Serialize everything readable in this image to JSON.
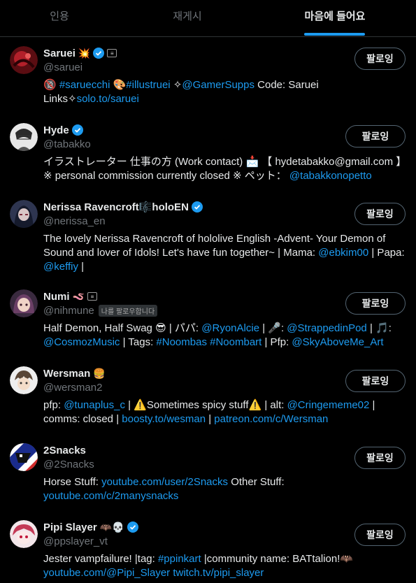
{
  "tabs": [
    {
      "label": "인용"
    },
    {
      "label": "재게시"
    },
    {
      "label": "마음에 들어요"
    }
  ],
  "colors": {
    "link": "#1d9bf0",
    "verified": "#1d9bf0",
    "muted": "#71767b"
  },
  "users": [
    {
      "name": "Saruei",
      "name_emoji": "💥",
      "handle": "@saruei",
      "button": "팔로잉",
      "bio": [
        "🔞 ",
        {
          "l": "#saruecchi"
        },
        " 🎨",
        {
          "l": "#illustruei"
        },
        " ✧",
        {
          "l": "@GamerSupps"
        },
        " Code: Saruei Links✧",
        {
          "l": "solo.to/saruei"
        }
      ]
    },
    {
      "name": "Hyde",
      "handle": "@tabakko",
      "button": "팔로잉",
      "bio": [
        "イラストレーター 仕事の方 (Work contact) 📩 【 hydetabakko@gmail.com 】 ※ personal commission currently closed ※ ペット： ",
        {
          "l": "@tabakkonopetto"
        }
      ]
    },
    {
      "name": "Nerissa Ravencroft🎼holoEN",
      "handle": "@nerissa_en",
      "button": "팔로잉",
      "bio": [
        "The lovely Nerissa Ravencroft of hololive English -Advent- Your Demon of Sound and lover of Idols! Let's have fun together~ | Mama: ",
        {
          "l": "@ebkim00"
        },
        " | Papa: ",
        {
          "l": "@keffiy"
        },
        " |"
      ]
    },
    {
      "name": "Numi",
      "name_emoji": "🪱",
      "handle": "@nihmune",
      "follows_you": "나를 팔로우합니다",
      "button": "팔로잉",
      "bio": [
        "Half Demon, Half Swag 😎 | パパ: ",
        {
          "l": "@RyonAlcie"
        },
        " | 🎤: ",
        {
          "l": "@StrappedinPod"
        },
        " | 🎵: ",
        {
          "l": "@CosmozMusic"
        },
        " | Tags: ",
        {
          "l": "#Noombas"
        },
        " ",
        {
          "l": "#Noombart"
        },
        " | Pfp: ",
        {
          "l": "@SkyAboveMe_Art"
        }
      ]
    },
    {
      "name": "Wersman",
      "name_emoji": "🍔",
      "handle": "@wersman2",
      "button": "팔로잉",
      "bio": [
        "pfp: ",
        {
          "l": "@tunaplus_c"
        },
        " | ⚠️Sometimes spicy stuff⚠️ | alt: ",
        {
          "l": "@Cringememe02"
        },
        " | comms: closed | ",
        {
          "l": "boosty.to/wesman"
        },
        " | ",
        {
          "l": "patreon.com/c/Wersman"
        }
      ]
    },
    {
      "name": "2Snacks",
      "handle": "@2Snacks",
      "button": "팔로잉",
      "bio": [
        "Horse Stuff: ",
        {
          "l": "youtube.com/user/2Snacks"
        },
        " Other Stuff: ",
        {
          "l": "youtube.com/c/2manysnacks"
        }
      ]
    },
    {
      "name": "Pipi Slayer",
      "name_emoji": "🦇💀",
      "handle": "@ppslayer_vt",
      "button": "팔로잉",
      "bio": [
        "Jester vampfailure! |tag: ",
        {
          "l": "#ppinkart"
        },
        " |community name: BATtalion!🦇 ",
        {
          "l": "youtube.com/@Pipi_Slayer"
        },
        " ",
        {
          "l": "twitch.tv/pipi_slayer"
        }
      ]
    }
  ]
}
